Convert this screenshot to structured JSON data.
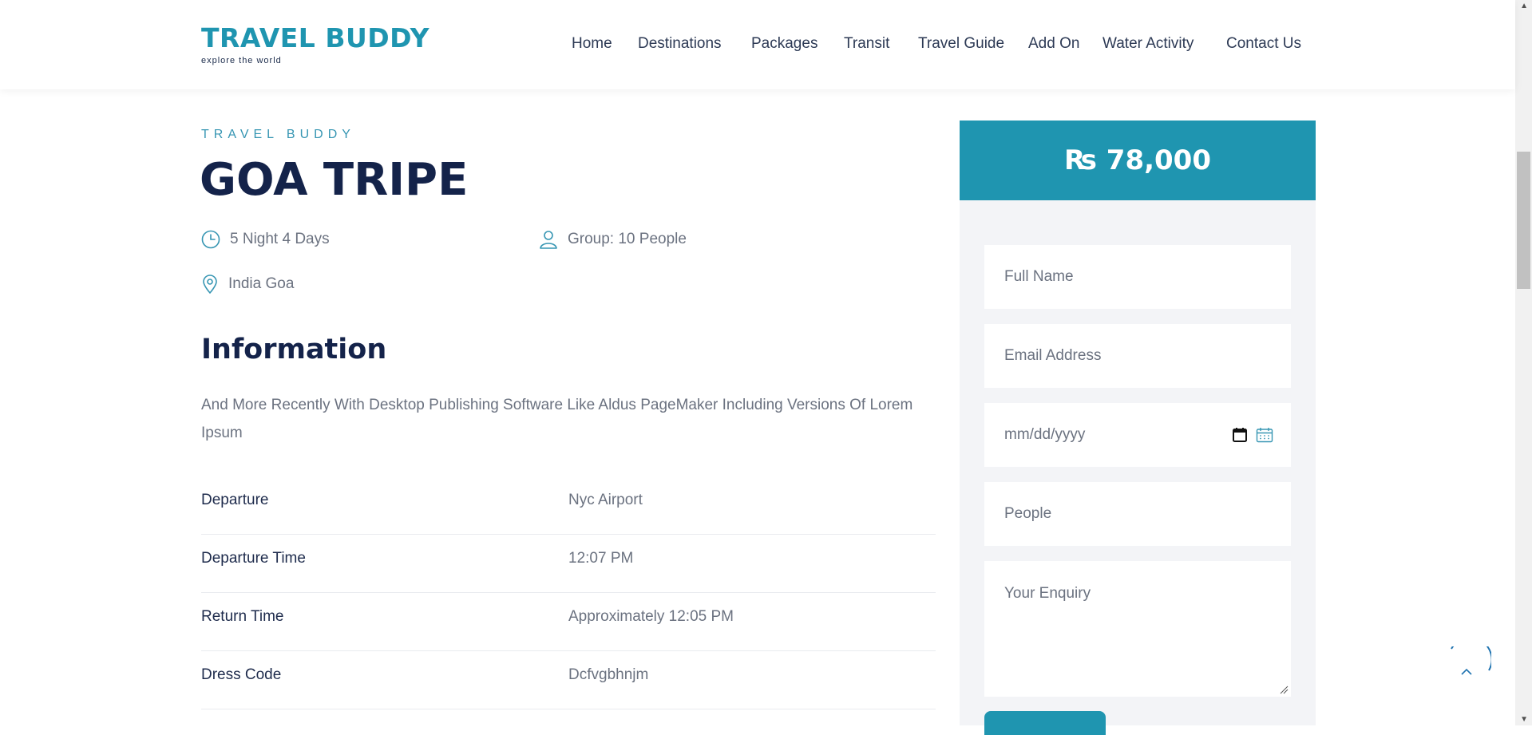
{
  "header": {
    "logo_title": "TRAVEL BUDDY",
    "logo_subtitle": "explore the world",
    "nav": [
      {
        "label": "Home"
      },
      {
        "label": "Destinations"
      },
      {
        "label": "Packages"
      },
      {
        "label": "Transit"
      },
      {
        "label": "Travel Guide"
      },
      {
        "label": "Add On"
      },
      {
        "label": "Water Activity"
      },
      {
        "label": "Contact Us"
      }
    ]
  },
  "tour": {
    "eyebrow": "TRAVEL BUDDY",
    "title": "GOA TRIPE",
    "duration": "5 Night 4 Days",
    "group": "Group: 10 People",
    "location": "India Goa"
  },
  "information": {
    "heading": "Information",
    "text": "And More Recently With Desktop Publishing Software Like Aldus PageMaker Including Versions Of Lorem Ipsum",
    "rows": [
      {
        "label": "Departure",
        "value": "Nyc Airport"
      },
      {
        "label": "Departure Time",
        "value": "12:07 PM"
      },
      {
        "label": "Return Time",
        "value": "Approximately 12:05 PM"
      },
      {
        "label": "Dress Code",
        "value": "Dcfvgbhnjm"
      }
    ]
  },
  "booking": {
    "price": "₨ 78,000",
    "full_name_placeholder": "Full Name",
    "email_placeholder": "Email Address",
    "date_placeholder": "mm/dd/yyyy",
    "people_placeholder": "People",
    "enquiry_placeholder": "Your Enquiry"
  },
  "colors": {
    "accent": "#1f95b0",
    "heading": "#14234a",
    "panel": "#f3f4f7"
  }
}
